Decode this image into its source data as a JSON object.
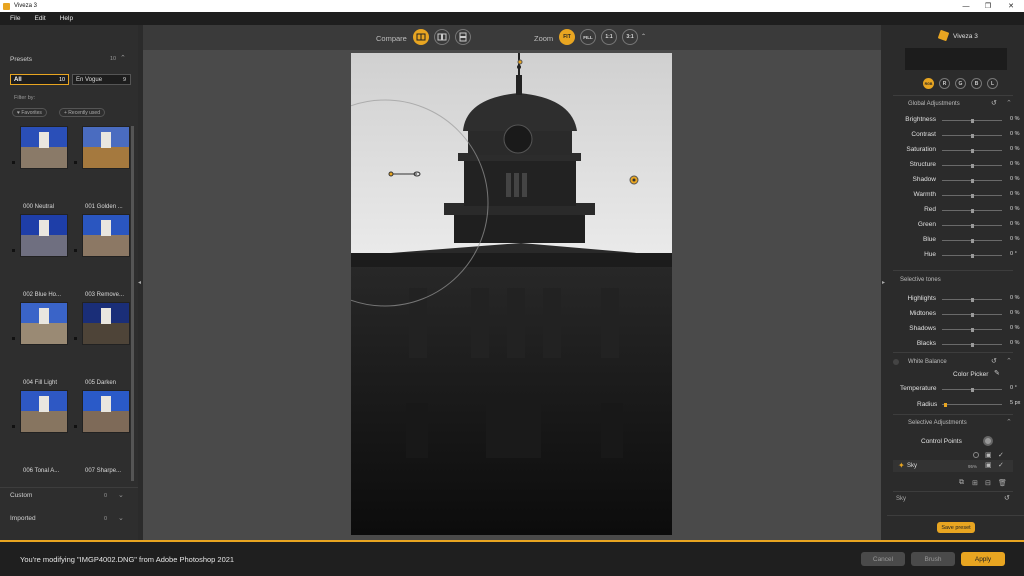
{
  "window": {
    "title": "Viveza 3",
    "min": "—",
    "max": "❐",
    "close": "✕"
  },
  "menu": [
    "File",
    "Edit",
    "Help"
  ],
  "left": {
    "presets_label": "Presets",
    "presets_count": "10",
    "tab_all": "All",
    "tab_all_count": "10",
    "tab_vogue": "En Vogue",
    "tab_vogue_count": "9",
    "filter_by": "Filter by:",
    "chip_fav": "♥ Favorites",
    "chip_recent": "+ Recently used",
    "thumbs": [
      "000 Neutral",
      "001 Golden ...",
      "002 Blue Ho...",
      "003 Remove...",
      "004 Fill Light",
      "005 Darken",
      "006 Tonal A...",
      "007 Sharpe..."
    ],
    "custom_label": "Custom",
    "custom_count": "0",
    "imported_label": "Imported",
    "imported_count": "0"
  },
  "toolbar": {
    "compare_label": "Compare",
    "zoom_label": "Zoom",
    "zoom_fit": "FIT",
    "zoom_fill": "FILL",
    "zoom_1": "1:1",
    "zoom_3": "3:1",
    "zoom_caret": "⌃"
  },
  "right": {
    "app_name": "Viveza 3",
    "channels": [
      "RGB",
      "R",
      "G",
      "B",
      "L"
    ],
    "global_title": "Global Adjustments",
    "global_rows": [
      {
        "label": "Brightness",
        "value": "0 %",
        "level": 0.5
      },
      {
        "label": "Contrast",
        "value": "0 %",
        "level": 0.5
      },
      {
        "label": "Saturation",
        "value": "0 %",
        "level": 0.5
      },
      {
        "label": "Structure",
        "value": "0 %",
        "level": 0.5
      },
      {
        "label": "Shadow",
        "value": "0 %",
        "level": 0.5
      },
      {
        "label": "Warmth",
        "value": "0 %",
        "level": 0.5
      },
      {
        "label": "Red",
        "value": "0 %",
        "level": 0.5
      },
      {
        "label": "Green",
        "value": "0 %",
        "level": 0.5
      },
      {
        "label": "Blue",
        "value": "0 %",
        "level": 0.5
      },
      {
        "label": "Hue",
        "value": "0 °",
        "level": 0.5
      }
    ],
    "tones_title": "Selective tones",
    "tones_rows": [
      {
        "label": "Highlights",
        "value": "0 %",
        "level": 0.5
      },
      {
        "label": "Midtones",
        "value": "0 %",
        "level": 0.5
      },
      {
        "label": "Shadows",
        "value": "0 %",
        "level": 0.5
      },
      {
        "label": "Blacks",
        "value": "0 %",
        "level": 0.5
      }
    ],
    "wb_title": "White Balance",
    "color_picker": "Color Picker",
    "temperature_label": "Temperature",
    "temperature_value": "0 °",
    "radius_label": "Radius",
    "radius_value": "5 px",
    "sel_title": "Selective Adjustments",
    "control_points": "Control Points",
    "cp_name": "Sky",
    "cp_pct": "95%",
    "footer_sky": "Sky",
    "save_preset": "Save preset"
  },
  "bottom": {
    "status": "You're modifying \"IMGP4002.DNG\" from Adobe Photoshop 2021",
    "cancel": "Cancel",
    "brush": "Brush",
    "apply": "Apply"
  },
  "colors": {
    "accent": "#e8a521",
    "panel": "#2e2e2e",
    "canvas": "#4a4a4a"
  }
}
